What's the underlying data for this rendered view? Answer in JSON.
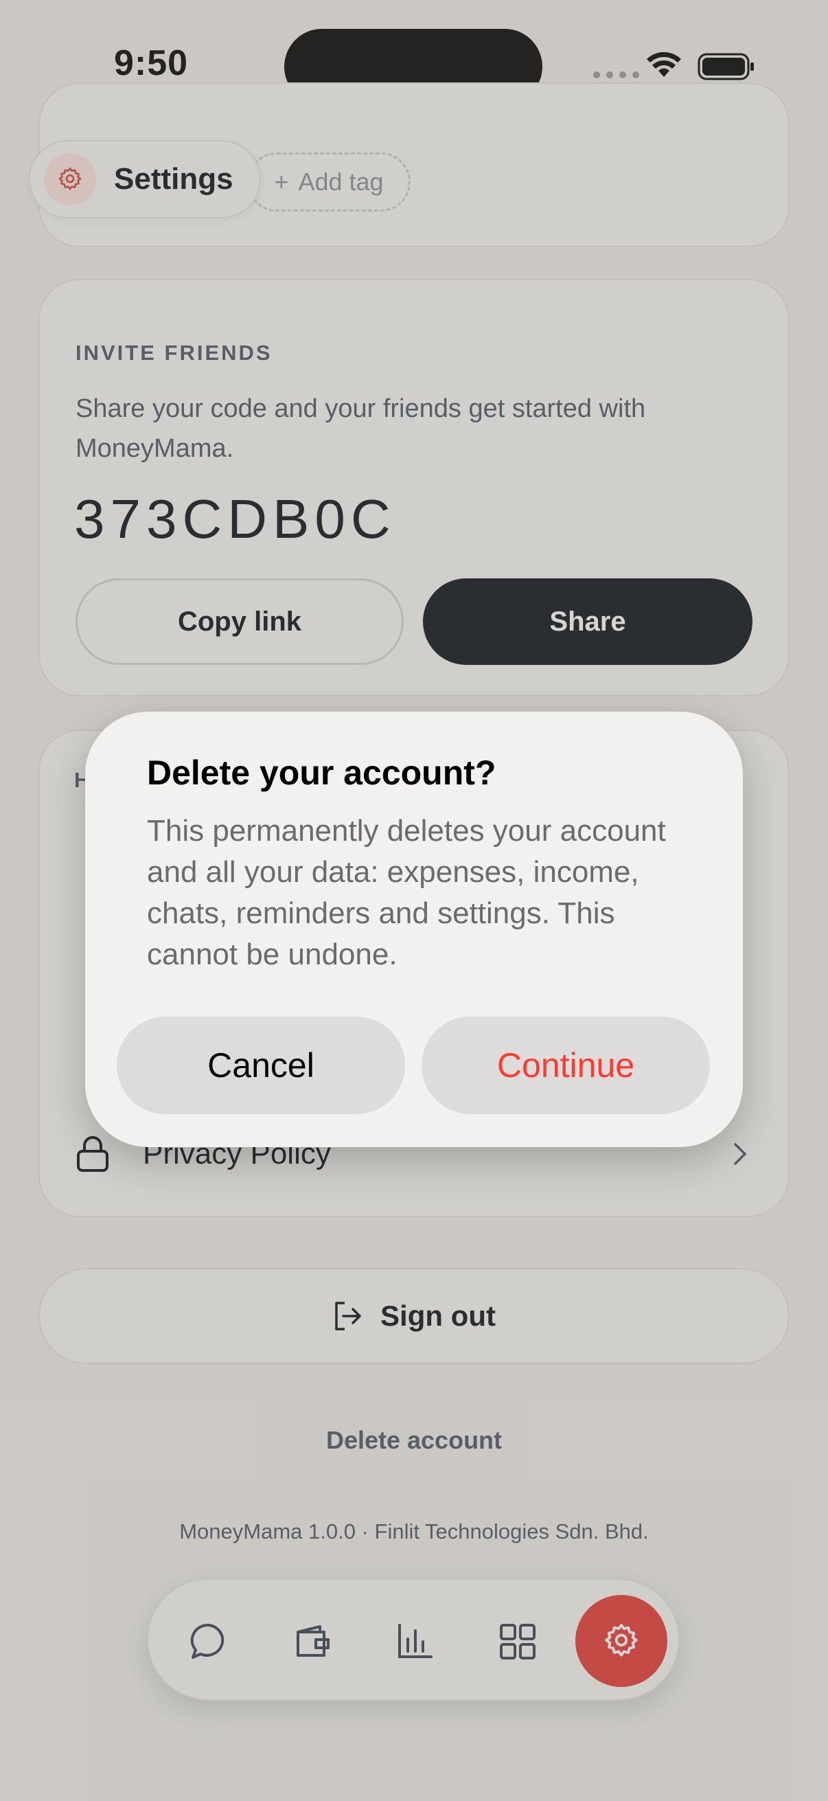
{
  "status_bar": {
    "time": "9:50"
  },
  "header": {
    "title": "Settings"
  },
  "tags": {
    "add_label": "Add tag"
  },
  "invite": {
    "title": "INVITE FRIENDS",
    "description": "Share your code and your friends get started with MoneyMama.",
    "code": "373CDB0C",
    "copy_label": "Copy link",
    "share_label": "Share"
  },
  "help": {
    "title": "H",
    "privacy_label": "Privacy Policy"
  },
  "account": {
    "sign_out_label": "Sign out",
    "delete_label": "Delete account"
  },
  "footer": {
    "text": "MoneyMama 1.0.0 · Finlit Technologies Sdn. Bhd."
  },
  "tabbar": {
    "items": [
      "chat-icon",
      "wallet-icon",
      "chart-icon",
      "grid-icon",
      "gear-icon"
    ],
    "active": "gear-icon",
    "accent": "#e53935"
  },
  "dialog": {
    "title": "Delete your account?",
    "body": "This permanently deletes your account and all your data: expenses, income, chats, reminders and settings. This cannot be undone.",
    "cancel_label": "Cancel",
    "continue_label": "Continue",
    "destructive_color": "#ff3b30"
  }
}
